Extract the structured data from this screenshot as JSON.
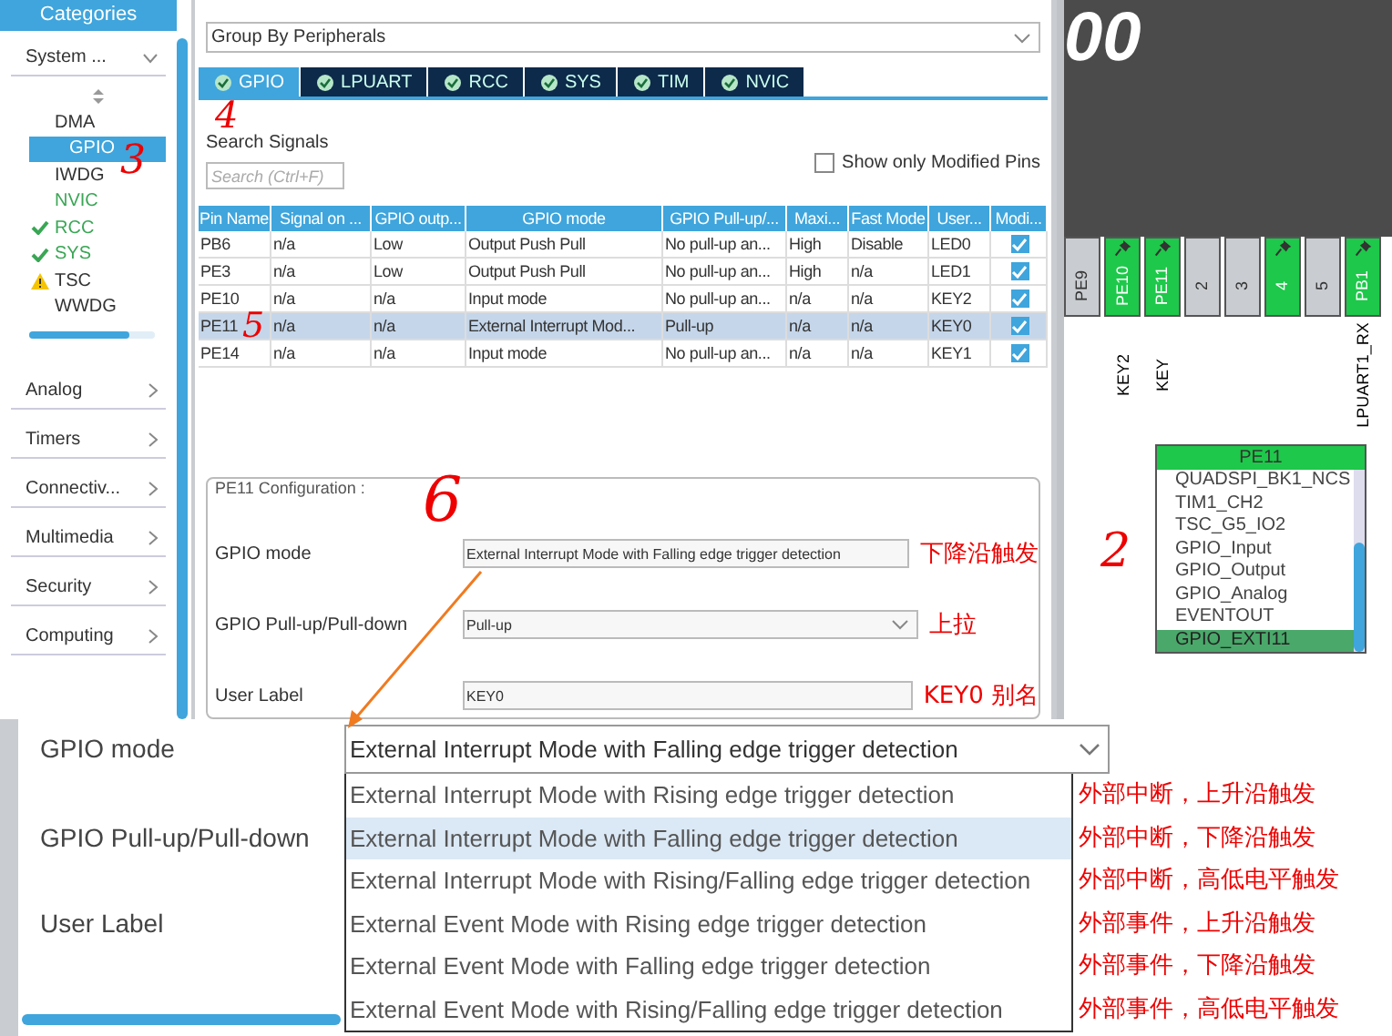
{
  "sidebar": {
    "header": "Categories",
    "group": {
      "label": "System ...",
      "expanded": true,
      "items": [
        {
          "label": "DMA",
          "selected": false,
          "kind": "plain",
          "configured": false
        },
        {
          "label": "GPIO",
          "selected": true,
          "kind": "plain",
          "configured": false
        },
        {
          "label": "IWDG",
          "selected": false,
          "kind": "plain",
          "configured": false
        },
        {
          "label": "NVIC",
          "selected": false,
          "kind": "plain",
          "configured": true
        },
        {
          "label": "RCC",
          "selected": false,
          "kind": "ok",
          "configured": true
        },
        {
          "label": "SYS",
          "selected": false,
          "kind": "ok",
          "configured": true
        },
        {
          "label": "TSC",
          "selected": false,
          "kind": "warning",
          "configured": false
        },
        {
          "label": "WWDG",
          "selected": false,
          "kind": "plain",
          "configured": false
        }
      ]
    },
    "sections": [
      "Analog",
      "Timers",
      "Connectiv...",
      "Multimedia",
      "Security",
      "Computing"
    ]
  },
  "group_by": "Group By Peripherals",
  "tabs": [
    {
      "label": "GPIO",
      "selected": true
    },
    {
      "label": "LPUART",
      "selected": false
    },
    {
      "label": "RCC",
      "selected": false
    },
    {
      "label": "SYS",
      "selected": false
    },
    {
      "label": "TIM",
      "selected": false
    },
    {
      "label": "NVIC",
      "selected": false
    }
  ],
  "search": {
    "label": "Search Signals",
    "placeholder": "Search (Ctrl+F)"
  },
  "show_modified": {
    "label": "Show only Modified Pins",
    "checked": false
  },
  "table": {
    "columns": [
      "Pin Name",
      "Signal on ...",
      "GPIO outp...",
      "GPIO mode",
      "GPIO Pull-up/...",
      "Maxi...",
      "Fast Mode",
      "User...",
      "Modi..."
    ],
    "rows": [
      {
        "cells": [
          "PB6",
          "n/a",
          "Low",
          "Output Push Pull",
          "No pull-up an...",
          "High",
          "Disable",
          "LED0"
        ],
        "modified": true,
        "selected": false
      },
      {
        "cells": [
          "PE3",
          "n/a",
          "Low",
          "Output Push Pull",
          "No pull-up an...",
          "High",
          "n/a",
          "LED1"
        ],
        "modified": true,
        "selected": false
      },
      {
        "cells": [
          "PE10",
          "n/a",
          "n/a",
          "Input mode",
          "No pull-up an...",
          "n/a",
          "n/a",
          "KEY2"
        ],
        "modified": true,
        "selected": false
      },
      {
        "cells": [
          "PE11",
          "n/a",
          "n/a",
          "External Interrupt Mod...",
          "Pull-up",
          "n/a",
          "n/a",
          "KEY0"
        ],
        "modified": true,
        "selected": true
      },
      {
        "cells": [
          "PE14",
          "n/a",
          "n/a",
          "Input mode",
          "No pull-up an...",
          "n/a",
          "n/a",
          "KEY1"
        ],
        "modified": true,
        "selected": false
      }
    ]
  },
  "config": {
    "title": "PE11 Configuration :",
    "fields": [
      {
        "label": "GPIO mode",
        "value": "External Interrupt Mode with Falling edge trigger detection",
        "kind": "text",
        "note": "下降沿触发"
      },
      {
        "label": "GPIO Pull-up/Pull-down",
        "value": "Pull-up",
        "kind": "select",
        "note": "上拉"
      },
      {
        "label": "User Label",
        "value": "KEY0",
        "kind": "text",
        "note": "KEY0 别名"
      }
    ]
  },
  "chip": {
    "title": "00",
    "pins": [
      {
        "label": "PE9",
        "assigned": false,
        "pinned": false
      },
      {
        "label": "PE10",
        "assigned": true,
        "pinned": true,
        "signal": "KEY2"
      },
      {
        "label": "PE11",
        "assigned": true,
        "pinned": true,
        "signal": "KEY"
      },
      {
        "label": "2",
        "assigned": false,
        "pinned": false
      },
      {
        "label": "3",
        "assigned": false,
        "pinned": false
      },
      {
        "label": "4",
        "assigned": true,
        "pinned": true
      },
      {
        "label": "5",
        "assigned": false,
        "pinned": false
      },
      {
        "label": "PB1",
        "assigned": true,
        "pinned": true,
        "signal": "LPUART1_RX"
      }
    ]
  },
  "pin_menu": {
    "title": "PE11",
    "items": [
      {
        "label": "QUADSPI_BK1_NCS",
        "selected": false
      },
      {
        "label": "TIM1_CH2",
        "selected": false
      },
      {
        "label": "TSC_G5_IO2",
        "selected": false
      },
      {
        "label": "GPIO_Input",
        "selected": false
      },
      {
        "label": "GPIO_Output",
        "selected": false
      },
      {
        "label": "GPIO_Analog",
        "selected": false
      },
      {
        "label": "EVENTOUT",
        "selected": false
      },
      {
        "label": "GPIO_EXTI11",
        "selected": true
      }
    ]
  },
  "annotations": [
    "3",
    "4",
    "5",
    "6",
    "2"
  ],
  "inset": {
    "fields": [
      "GPIO mode",
      "GPIO Pull-up/Pull-down",
      "User Label"
    ],
    "value": "External Interrupt Mode with Falling edge trigger detection",
    "options": [
      {
        "label": "External Interrupt Mode with Rising edge trigger detection",
        "selected": false,
        "note": "外部中断，上升沿触发"
      },
      {
        "label": "External Interrupt Mode with Falling edge trigger detection",
        "selected": true,
        "note": "外部中断，下降沿触发"
      },
      {
        "label": "External Interrupt Mode with Rising/Falling edge trigger detection",
        "selected": false,
        "note": "外部中断，高低电平触发"
      },
      {
        "label": "External Event Mode with Rising edge trigger detection",
        "selected": false,
        "note": "外部事件，上升沿触发"
      },
      {
        "label": "External Event Mode with Falling edge trigger detection",
        "selected": false,
        "note": "外部事件，下降沿触发"
      },
      {
        "label": "External Event Mode with Rising/Falling edge trigger detection",
        "selected": false,
        "note": "外部事件，高低电平触发"
      }
    ]
  }
}
